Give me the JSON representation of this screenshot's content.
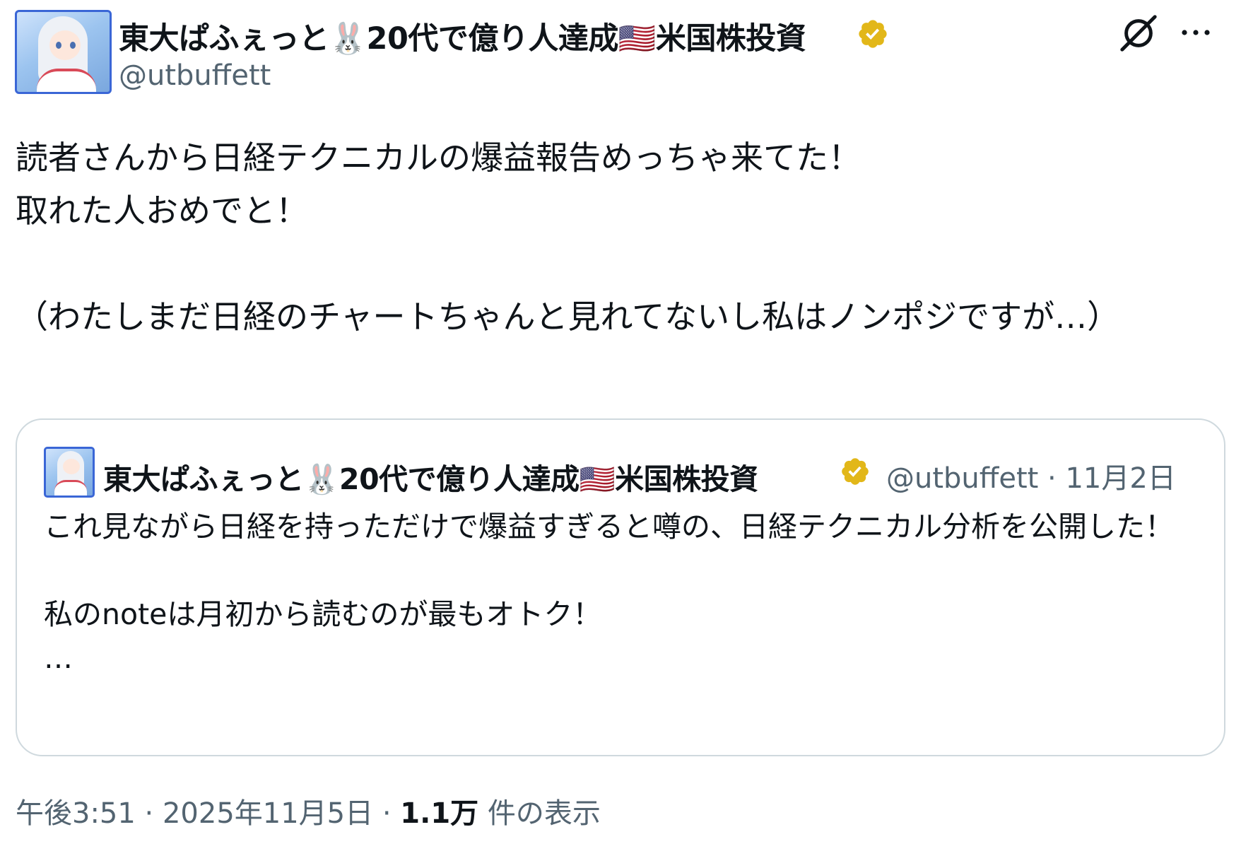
{
  "author": {
    "display_name": "東大ぱふぇっと🐰20代で億り人達成🇺🇸米国株投資",
    "handle": "@utbuffett"
  },
  "post": {
    "text": "読者さんから日経テクニカルの爆益報告めっちゃ来てた！\n取れた人おめでと！\n\n（わたしまだ日経のチャートちゃんと見れてないし私はノンポジですが…）"
  },
  "quoted": {
    "display_name": "東大ぱふぇっと🐰20代で億り人達成🇺🇸米国株投資",
    "handle": "@utbuffett",
    "separator": "·",
    "date": "11月2日",
    "text": "これ見ながら日経を持っただけで爆益すぎると噂の、日経テクニカル分析を公開した！\n\n私のnoteは月初から読むのが最もオトク！\n…"
  },
  "footer": {
    "time": "午後3:51",
    "sep1": "·",
    "date": "2025年11月5日",
    "sep2": "·",
    "views_count": "1.1万",
    "views_label": "件の表示"
  },
  "colors": {
    "verified": "#e2b719",
    "secondary_text": "#536471",
    "border": "#cfd9de"
  }
}
